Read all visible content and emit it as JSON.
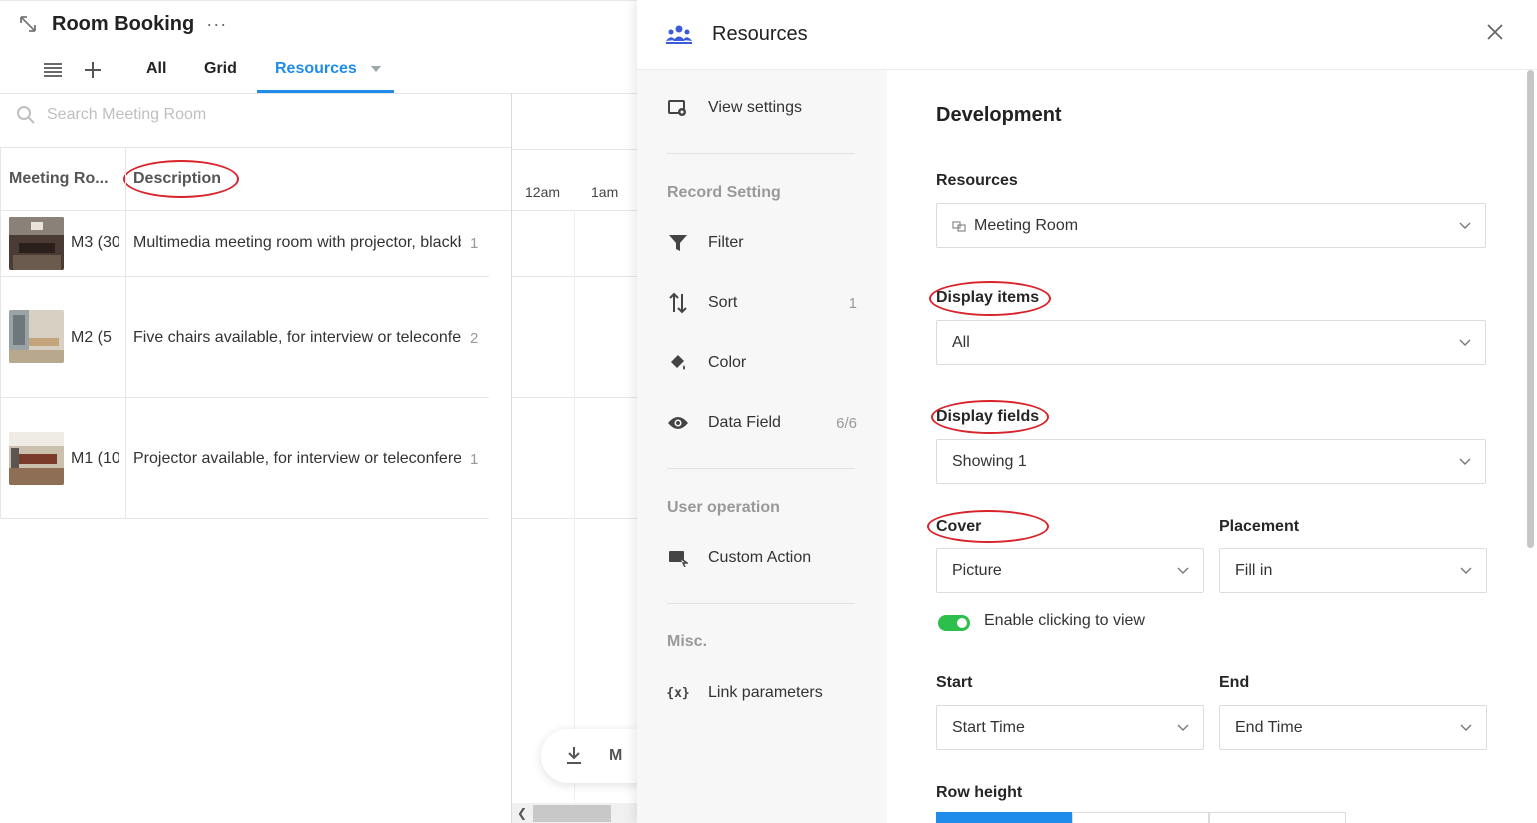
{
  "app": {
    "title": "Room Booking",
    "more": "···",
    "tabs": [
      {
        "label": "All"
      },
      {
        "label": "Grid"
      },
      {
        "label": "Resources"
      }
    ],
    "search_placeholder": "Search Meeting Room",
    "columns": [
      "Meeting Ro...",
      "Description"
    ],
    "rows": [
      {
        "name": "M3 (30",
        "desc": "Multimedia meeting room with projector, blackboard",
        "num": "1"
      },
      {
        "name": "M2 (5",
        "desc": "Five chairs available, for interview or teleconference",
        "num": "2"
      },
      {
        "name": "M1 (10",
        "desc": "Projector available, for interview or teleconference",
        "num": "1"
      }
    ],
    "time_labels": [
      "12am",
      "1am"
    ],
    "float_label": "M"
  },
  "panel": {
    "title": "Resources",
    "menu": {
      "view_settings": "View settings",
      "record_setting": "Record Setting",
      "filter": "Filter",
      "sort": "Sort",
      "sort_count": "1",
      "color": "Color",
      "data_field": "Data Field",
      "data_field_count": "6/6",
      "user_operation": "User operation",
      "custom_action": "Custom Action",
      "misc": "Misc.",
      "link_parameters": "Link parameters"
    },
    "content": {
      "section": "Development",
      "resources_label": "Resources",
      "resources_value": "Meeting Room",
      "display_items_label": "Display items",
      "display_items_value": "All",
      "display_fields_label": "Display fields",
      "display_fields_value": "Showing 1",
      "cover_label": "Cover",
      "cover_value": "Picture",
      "placement_label": "Placement",
      "placement_value": "Fill in",
      "toggle_label": "Enable clicking to view",
      "toggle_on": true,
      "start_label": "Start",
      "start_value": "Start Time",
      "end_label": "End",
      "end_value": "End Time",
      "row_height_label": "Row height"
    }
  },
  "colors": {
    "accent": "#1f8ceb",
    "toggle": "#2cbf4b",
    "annotation": "#d8232a"
  }
}
